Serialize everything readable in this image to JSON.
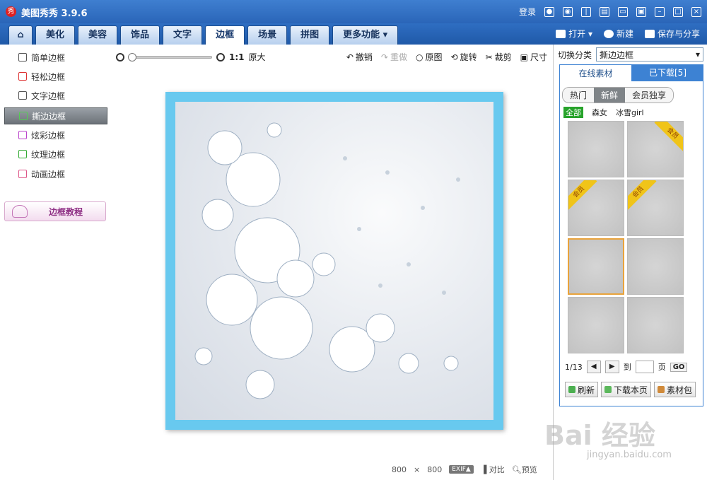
{
  "app": {
    "title": "美图秀秀 3.9.6",
    "logo_char": "秀"
  },
  "titlebar": {
    "login": "登录"
  },
  "tabs": [
    {
      "label": ""
    },
    {
      "label": "美化"
    },
    {
      "label": "美容"
    },
    {
      "label": "饰品"
    },
    {
      "label": "文字"
    },
    {
      "label": "边框"
    },
    {
      "label": "场景"
    },
    {
      "label": "拼图"
    },
    {
      "label": "更多功能 ▾"
    }
  ],
  "header_actions": {
    "open": "打开 ▾",
    "new": "新建",
    "save_share": "保存与分享"
  },
  "left_menu": [
    {
      "label": "简单边框"
    },
    {
      "label": "轻松边框"
    },
    {
      "label": "文字边框"
    },
    {
      "label": "撕边边框"
    },
    {
      "label": "炫彩边框"
    },
    {
      "label": "纹理边框"
    },
    {
      "label": "动画边框"
    }
  ],
  "tutorial": {
    "label": "边框教程"
  },
  "toolbar": {
    "zoom_ratio": "1:1",
    "original_size": "原大",
    "undo": "撤销",
    "redo": "重做",
    "original": "原图",
    "rotate": "旋转",
    "crop": "裁剪",
    "size": "尺寸"
  },
  "status": {
    "width": "800",
    "x": "×",
    "height": "800",
    "exif": "EXIF▲",
    "compare": "对比",
    "preview": "预览"
  },
  "right_panel": {
    "switch_label": "切换分类",
    "category": "撕边边框",
    "tab_online": "在线素材",
    "tab_downloaded": "已下载[5]",
    "filters": [
      "热门",
      "新鲜",
      "会员独享"
    ],
    "tags": [
      "全部",
      "森女",
      "冰雪girl"
    ],
    "member_ribbon": "会员",
    "page_info": "1/13",
    "goto": "到",
    "page_unit": "页",
    "go": "GO",
    "refresh": "刷新",
    "download_page": "下载本页",
    "material_pack": "素材包"
  },
  "watermark": {
    "brand": "Bai 经验",
    "url": "jingyan.baidu.com"
  },
  "colors": {
    "title_blue": "#2a65b8",
    "frame_cyan": "#68c9ef",
    "member_gold": "#f0c419",
    "select_orange": "#e9a33b"
  }
}
